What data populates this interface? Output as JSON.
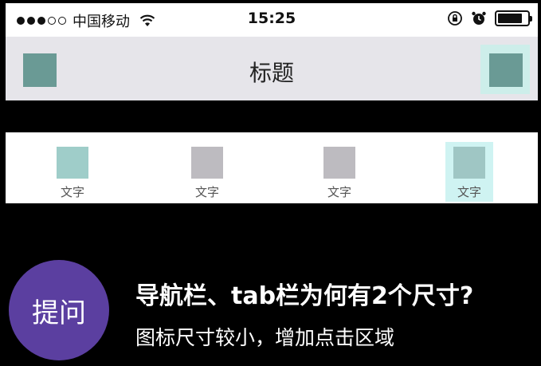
{
  "status_bar": {
    "carrier": "中国移动",
    "time": "15:25",
    "battery_level": 0.85
  },
  "nav_bar": {
    "title": "标题",
    "left_icon": "placeholder-square-icon",
    "right_icon": "placeholder-square-icon"
  },
  "tab_bar": {
    "tabs": [
      {
        "label": "文字",
        "icon_color": "#9fcdc9"
      },
      {
        "label": "文字",
        "icon_color": "#bdbbc0"
      },
      {
        "label": "文字",
        "icon_color": "#bdbbc0"
      },
      {
        "label": "文字",
        "icon_color": "#9fc6c4"
      }
    ]
  },
  "caption": {
    "badge": "提问",
    "headline": "导航栏、tab栏为何有2个尺寸?",
    "subline": "图标尺寸较小，增加点击区域"
  },
  "colors": {
    "placeholder_icon": "#6a9a95",
    "hit_area": "#cff3f2",
    "badge": "#5b3fa0"
  }
}
